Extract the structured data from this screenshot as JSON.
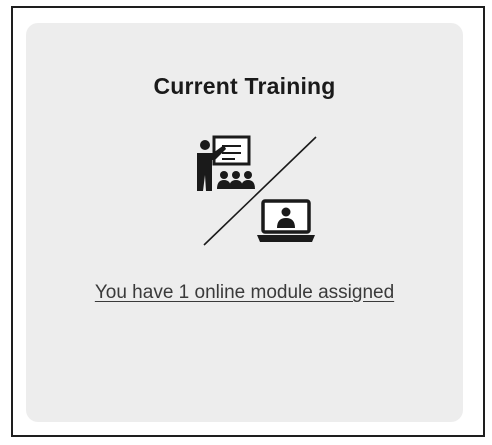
{
  "training_card": {
    "title": "Current Training",
    "link_text": "You have 1 online module assigned",
    "icons": {
      "in_person": "classroom-presenter-icon",
      "online": "laptop-video-icon"
    },
    "colors": {
      "card_background": "#ededed",
      "frame_border": "#1e1e1e",
      "text": "#1a1a1a",
      "link": "#3a3a3a"
    }
  }
}
